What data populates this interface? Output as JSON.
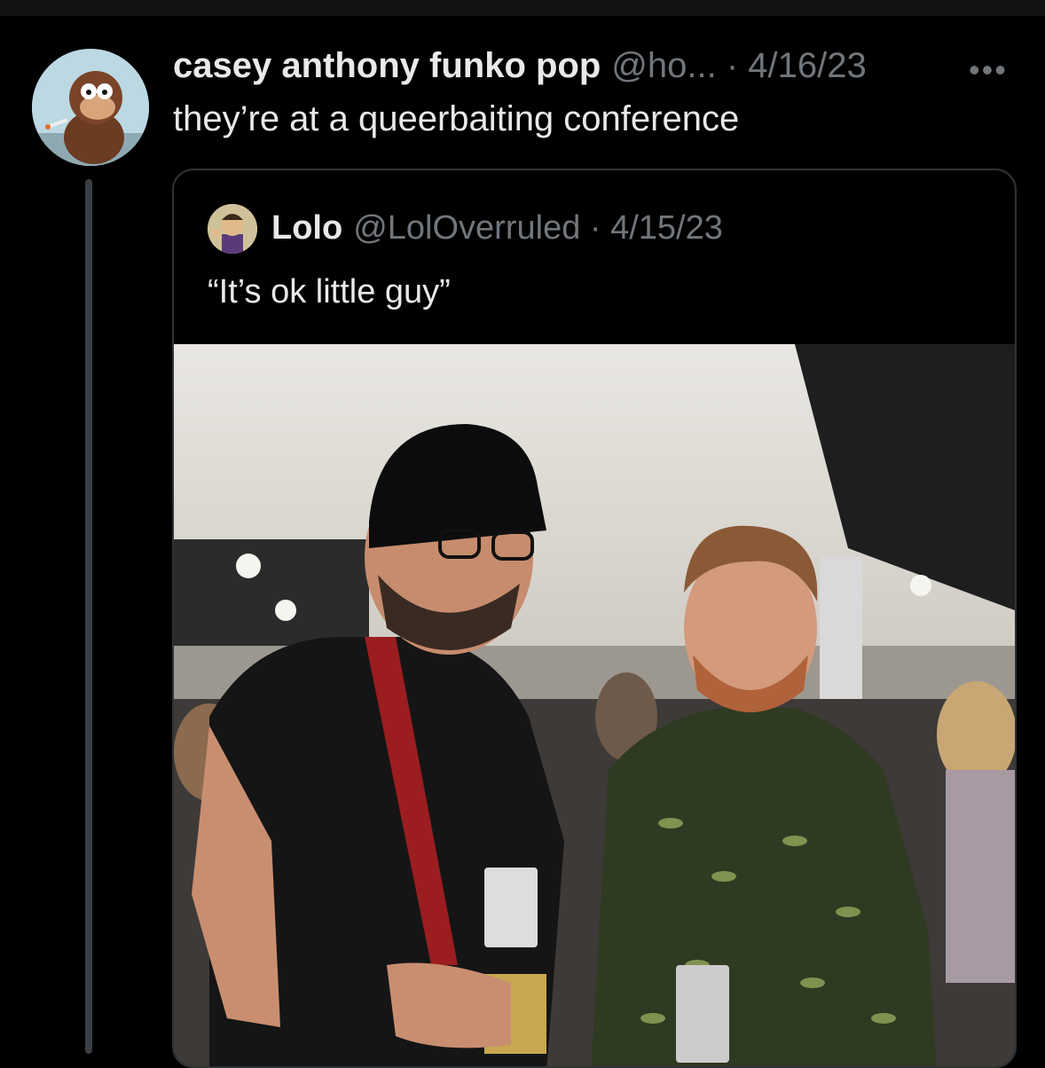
{
  "tweet": {
    "display_name": "casey anthony funko pop",
    "handle_date": "@ho... · 4/16/23",
    "more_icon": "more-horizontal-icon",
    "text": "they’re at a queerbaiting conference"
  },
  "quoted_tweet": {
    "display_name": "Lolo",
    "handle_date": "@LolOverruled · 4/15/23",
    "text": "“It’s ok little guy”"
  },
  "colors": {
    "background": "#000000",
    "primary_text": "#e7e9ea",
    "secondary_text": "#71767b",
    "border": "#2f3336"
  }
}
